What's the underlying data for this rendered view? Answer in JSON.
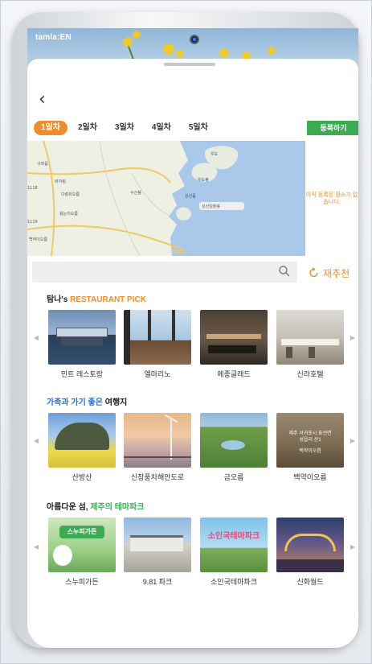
{
  "app": {
    "brand": "tamla:EN"
  },
  "nav": {
    "back_label": "‹"
  },
  "days": [
    {
      "label": "1일차",
      "active": true
    },
    {
      "label": "2일차",
      "active": false
    },
    {
      "label": "3일차",
      "active": false
    },
    {
      "label": "4일차",
      "active": false
    },
    {
      "label": "5일차",
      "active": false
    }
  ],
  "register_label": "등록하기",
  "map": {
    "side_message": "아직 등록된 장소가 없습니다.",
    "labels": [
      "구좌읍",
      "비자림",
      "다랑쉬오름",
      "용눈이오름",
      "백약이오름",
      "우도",
      "성산읍",
      "수산봉",
      "성산일출봉",
      "우도봉",
      "1118",
      "1119"
    ]
  },
  "search": {
    "placeholder": ""
  },
  "rerecommend_label": "재추천",
  "sections": [
    {
      "title_prefix": "탐나's ",
      "title_accent": "RESTAURANT PICK",
      "title_suffix": "",
      "accent_color": "#f08c2a",
      "items": [
        "민트 레스토랑",
        "엘마리노",
        "메종글래드",
        "신라호텔"
      ]
    },
    {
      "title_prefix": "",
      "title_accent": "가족과 가기 좋은",
      "title_suffix": " 여행지",
      "accent_color": "#2d6fd8",
      "items": [
        "산방산",
        "신창풍차해안도로",
        "금오름",
        "백약이오름"
      ]
    },
    {
      "title_prefix": "아름다운 섬, ",
      "title_accent": "제주의 테마파크",
      "title_suffix": "",
      "accent_color": "#3dab53",
      "items": [
        "스누피가든",
        "9.81 파크",
        "소인국테마파크",
        "신화월드"
      ]
    }
  ],
  "thumb_text": {
    "baekyak_line1": "제주 서귀포시 표선면",
    "baekyak_line2": "성읍리 산1",
    "baekyak_line3": "백약이오름",
    "snoopy_sign": "스누피가든",
    "sogukuk_sign": "소인국테마파크"
  },
  "colors": {
    "accent": "#f08c2a",
    "green": "#3dab53",
    "blue": "#2d6fd8"
  }
}
